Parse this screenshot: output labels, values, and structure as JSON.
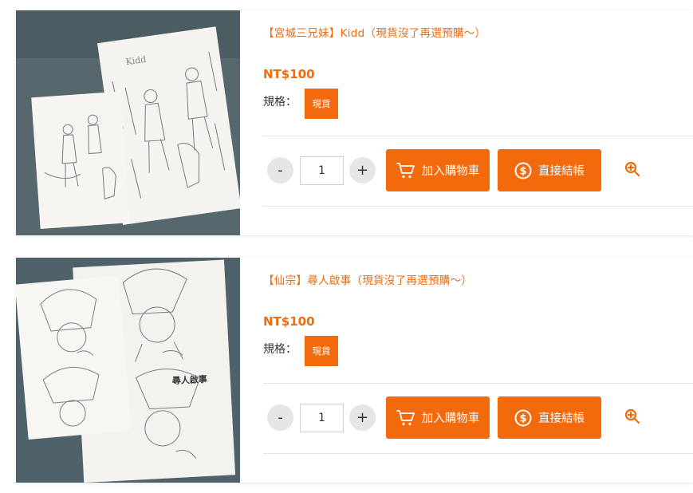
{
  "products": [
    {
      "title": "【宮城三兄妹】Kidd（現貨沒了再選預購～）",
      "price": "NT$100",
      "spec_label": "規格：",
      "spec_option": "現貨",
      "quantity": "1",
      "minus": "-",
      "plus": "+",
      "add_to_cart": "加入購物車",
      "checkout": "直接結帳",
      "image_icon": "book-photo-kidd",
      "book_cover_text": "Kidd"
    },
    {
      "title": "【仙宗】尋人啟事（現貨沒了再選預購～）",
      "price": "NT$100",
      "spec_label": "規格：",
      "spec_option": "現貨",
      "quantity": "1",
      "minus": "-",
      "plus": "+",
      "add_to_cart": "加入購物車",
      "checkout": "直接結帳",
      "image_icon": "book-photo-missing-person",
      "book_cover_text": "尋人啟事"
    }
  ],
  "icons": {
    "cart": "cart-icon",
    "checkout": "dollar-coin-icon",
    "zoom": "zoom-in-icon"
  },
  "colors": {
    "accent": "#f26a0c",
    "photo_bg": "#506269",
    "qty_button_bg": "#e6e6e6"
  }
}
